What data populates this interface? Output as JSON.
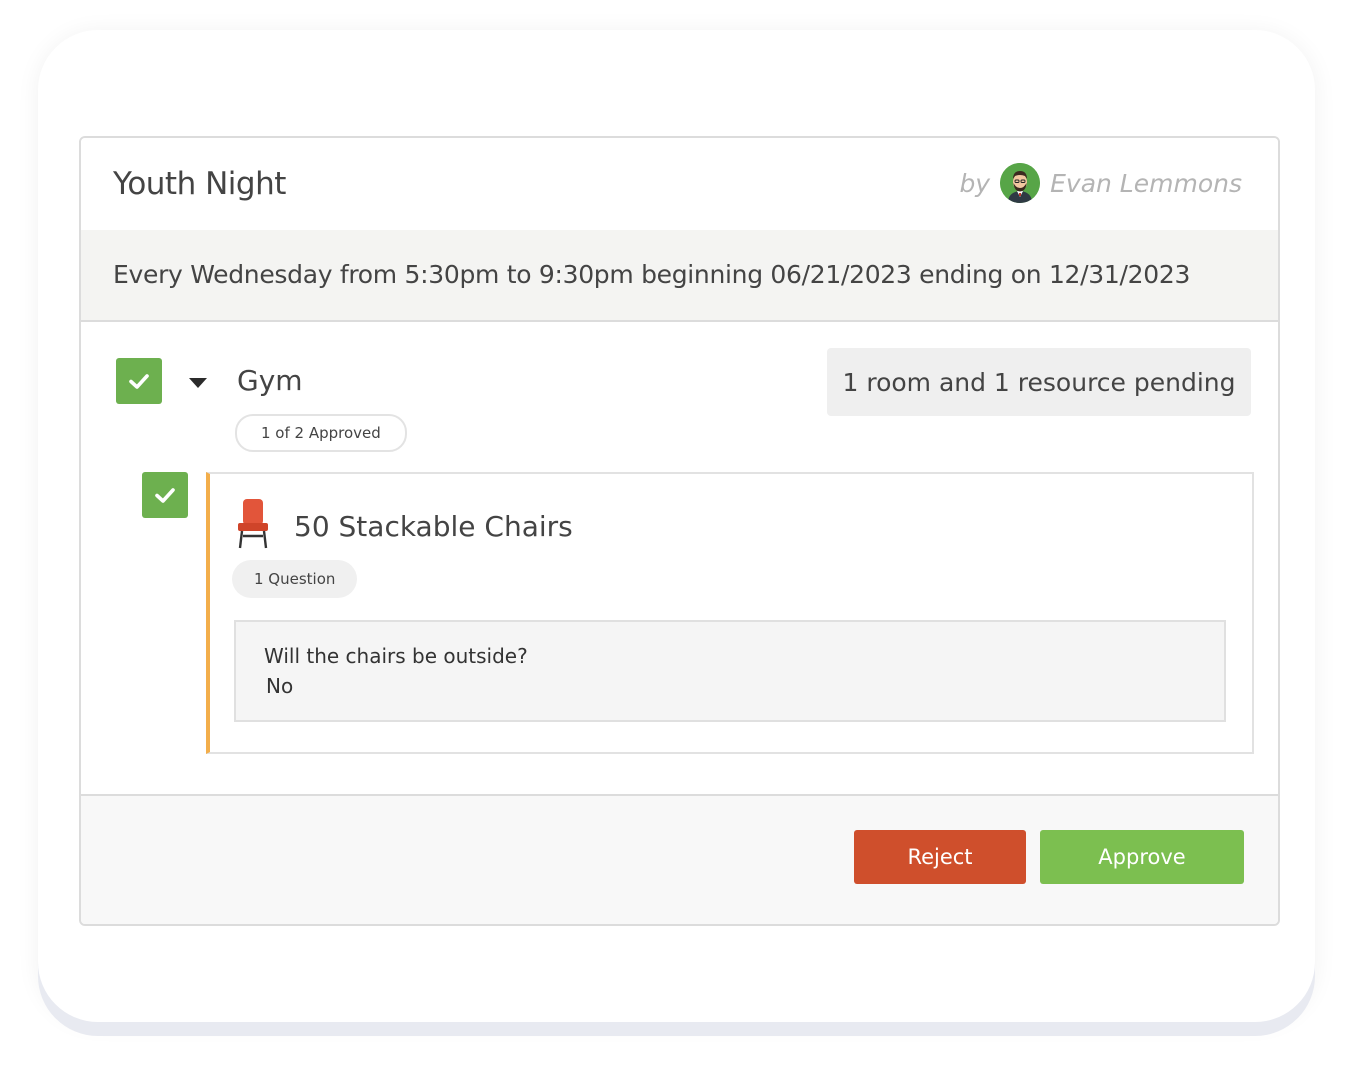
{
  "event": {
    "title": "Youth Night",
    "by_label": "by",
    "author_name": "Evan Lemmons",
    "schedule": "Every Wednesday from 5:30pm to 9:30pm beginning 06/21/2023 ending on 12/31/2023"
  },
  "room": {
    "name": "Gym",
    "approval_status": "1 of 2 Approved",
    "pending_summary": "1 room and 1 resource pending",
    "checked": true
  },
  "resource": {
    "name": "50 Stackable Chairs",
    "icon": "chair-icon",
    "question_count": "1 Question",
    "question": "Will the chairs be outside?",
    "answer": "No",
    "checked": true
  },
  "actions": {
    "reject_label": "Reject",
    "approve_label": "Approve"
  },
  "colors": {
    "check_green": "#6db04f",
    "reject_red": "#cf4f2c",
    "approve_green": "#7cbf50",
    "accent_orange": "#f3ae4b"
  }
}
